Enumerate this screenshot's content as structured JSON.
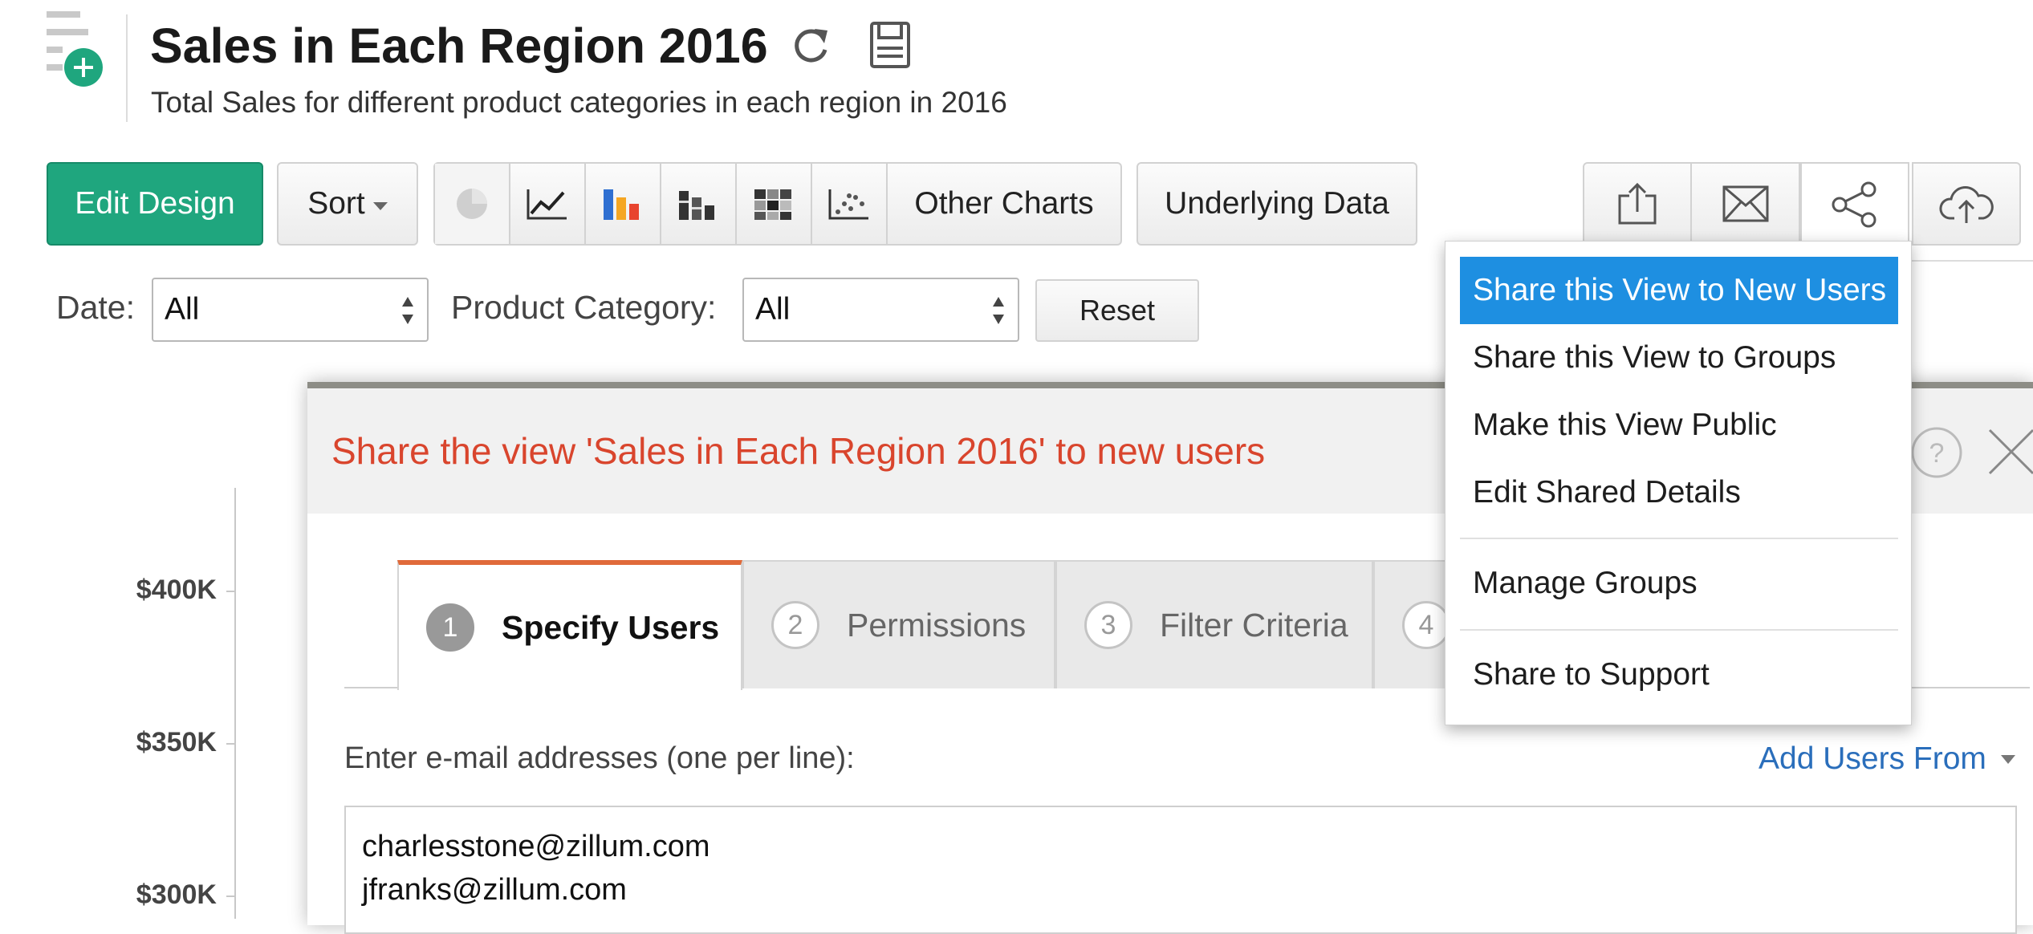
{
  "header": {
    "title": "Sales in Each Region 2016",
    "description": "Total Sales for different product categories in each region in 2016",
    "icons": [
      "add-view-icon",
      "refresh-icon",
      "save-icon"
    ]
  },
  "toolbar": {
    "edit_design": "Edit Design",
    "sort": "Sort",
    "chart_types": [
      "pie-chart-icon",
      "line-chart-icon",
      "bar-chart-icon",
      "stacked-bar-chart-icon",
      "heatmap-chart-icon",
      "scatter-chart-icon"
    ],
    "other_charts": "Other Charts",
    "underlying_data": "Underlying Data",
    "action_icons": [
      "export-icon",
      "email-icon",
      "share-icon",
      "publish-icon"
    ],
    "edit_color": "#1fa67e"
  },
  "filters": {
    "date_label": "Date:",
    "date_value": "All",
    "category_label": "Product Category:",
    "category_value": "All",
    "reset": "Reset"
  },
  "chart": {
    "y_ticks": [
      "$400K",
      "$350K",
      "$300K"
    ]
  },
  "dialog": {
    "title": "Share the view 'Sales in Each Region 2016' to new users",
    "title_color": "#d9452d",
    "tabs": [
      {
        "number": "1",
        "label": "Specify Users",
        "active": true
      },
      {
        "number": "2",
        "label": "Permissions",
        "active": false
      },
      {
        "number": "3",
        "label": "Filter Criteria",
        "active": false
      },
      {
        "number": "4",
        "label": "",
        "active": false
      }
    ],
    "email_label": "Enter e-mail addresses (one per line):",
    "add_users_from": "Add Users From",
    "emails": [
      "charlesstone@zillum.com",
      "jfranks@zillum.com"
    ]
  },
  "share_menu": {
    "items": [
      "Share this View to New Users",
      "Share this View to Groups",
      "Make this View Public",
      "Edit Shared Details",
      "Manage Groups",
      "Share to Support"
    ],
    "highlight_color": "#1e8fe1"
  }
}
